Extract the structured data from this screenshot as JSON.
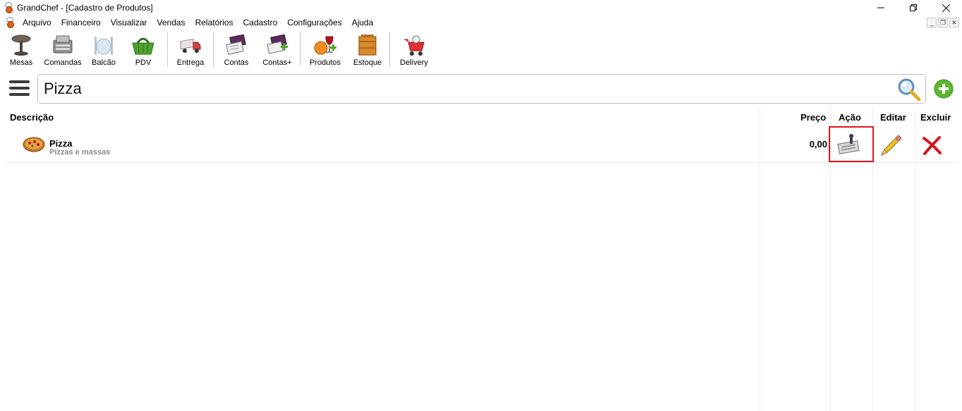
{
  "window": {
    "title": "GrandChef - [Cadastro de Produtos]"
  },
  "menu": {
    "items": [
      "Arquivo",
      "Financeiro",
      "Visualizar",
      "Vendas",
      "Relatórios",
      "Cadastro",
      "Configurações",
      "Ajuda"
    ]
  },
  "toolbar": {
    "buttons": [
      {
        "label": "Mesas",
        "icon": "table-icon"
      },
      {
        "label": "Comandas",
        "icon": "cash-register-icon"
      },
      {
        "label": "Balcão",
        "icon": "cutlery-icon"
      },
      {
        "label": "PDV",
        "icon": "basket-icon"
      },
      {
        "label": "Entrega",
        "icon": "delivery-truck-icon"
      },
      {
        "label": "Contas",
        "icon": "accounts-icon"
      },
      {
        "label": "Contas+",
        "icon": "accounts-add-icon"
      },
      {
        "label": "Produtos",
        "icon": "products-icon"
      },
      {
        "label": "Estoque",
        "icon": "stock-box-icon"
      },
      {
        "label": "Delivery",
        "icon": "delivery-cart-icon"
      }
    ]
  },
  "search": {
    "value": "Pizza"
  },
  "table": {
    "headers": {
      "description": "Descrição",
      "price": "Preço",
      "action": "Ação",
      "edit": "Editar",
      "delete": "Excluir"
    },
    "rows": [
      {
        "name": "Pizza",
        "category": "Pizzas e massas",
        "price": "0,00"
      }
    ]
  },
  "colors": {
    "highlight": "#e0141e",
    "add_green": "#5cb82f"
  }
}
